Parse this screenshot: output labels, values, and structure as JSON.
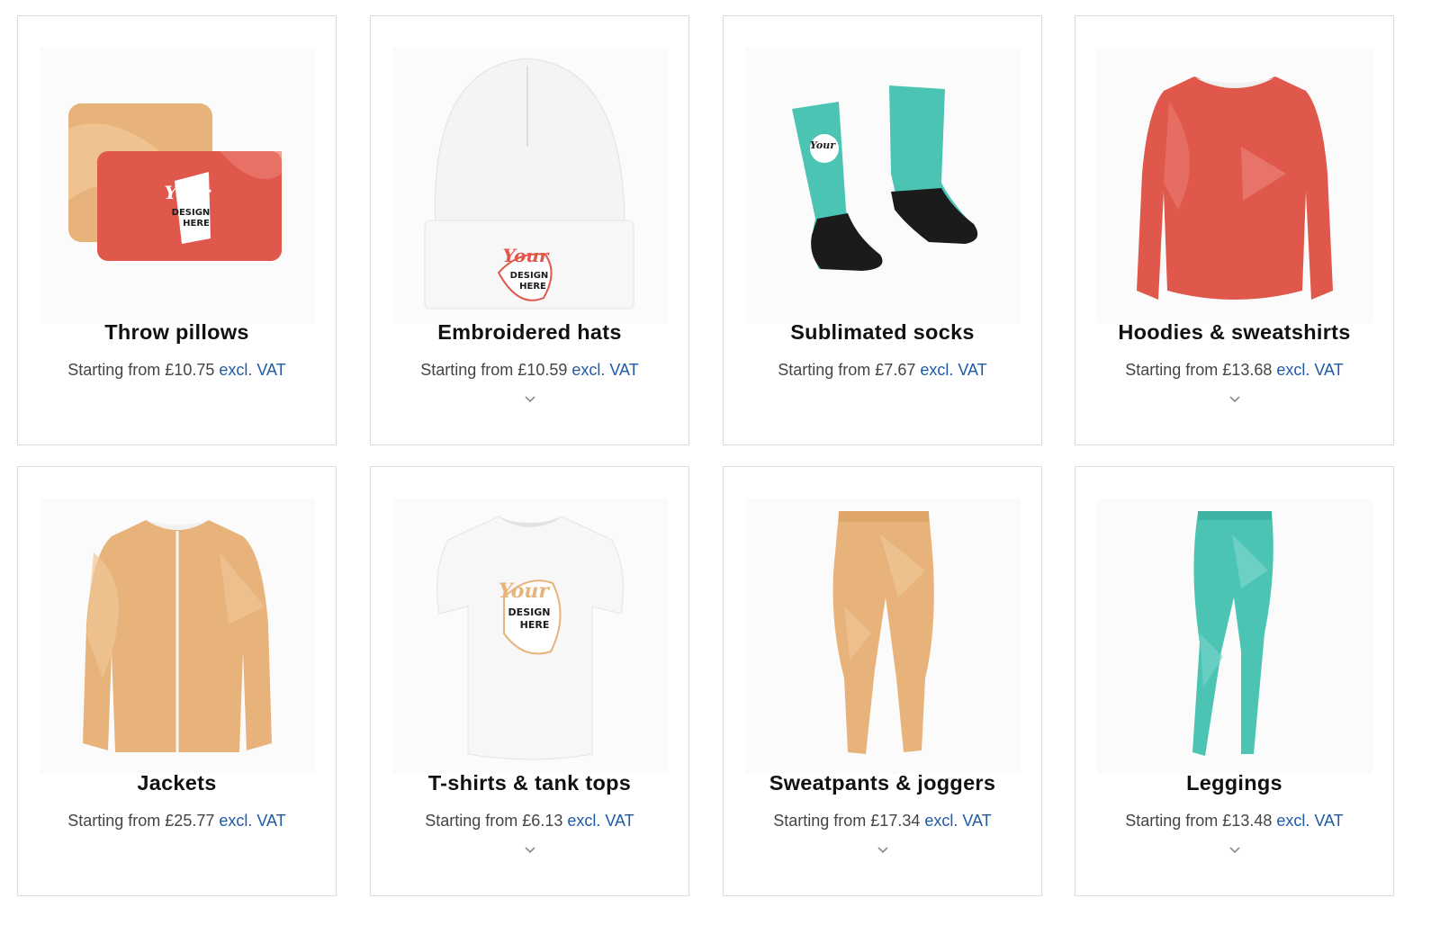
{
  "products": [
    {
      "title": "Throw pillows",
      "price_prefix": "Starting from £10.75",
      "vat_label": "excl. VAT",
      "art_icon": "pillow-icon",
      "has_chevron": false
    },
    {
      "title": "Embroidered hats",
      "price_prefix": "Starting from £10.59",
      "vat_label": "excl. VAT",
      "art_icon": "beanie-icon",
      "has_chevron": true
    },
    {
      "title": "Sublimated socks",
      "price_prefix": "Starting from £7.67",
      "vat_label": "excl. VAT",
      "art_icon": "socks-icon",
      "has_chevron": false
    },
    {
      "title": "Hoodies & sweatshirts",
      "price_prefix": "Starting from £13.68",
      "vat_label": "excl. VAT",
      "art_icon": "sweatshirt-icon",
      "has_chevron": true
    },
    {
      "title": "Jackets",
      "price_prefix": "Starting from £25.77",
      "vat_label": "excl. VAT",
      "art_icon": "jacket-icon",
      "has_chevron": false
    },
    {
      "title": "T-shirts & tank tops",
      "price_prefix": "Starting from £6.13",
      "vat_label": "excl. VAT",
      "art_icon": "tshirt-icon",
      "has_chevron": true
    },
    {
      "title": "Sweatpants & joggers",
      "price_prefix": "Starting from £17.34",
      "vat_label": "excl. VAT",
      "art_icon": "joggers-icon",
      "has_chevron": true
    },
    {
      "title": "Leggings",
      "price_prefix": "Starting from £13.48",
      "vat_label": "excl. VAT",
      "art_icon": "leggings-icon",
      "has_chevron": true
    }
  ],
  "mockup_text": {
    "line1": "Your",
    "line2": "DESIGN",
    "line3": "HERE"
  },
  "colors": {
    "accent_link": "#1f5aa6",
    "coral": "#e0574b",
    "sand": "#e8b37a",
    "teal": "#4cc4b4",
    "black": "#1b1b1b"
  }
}
